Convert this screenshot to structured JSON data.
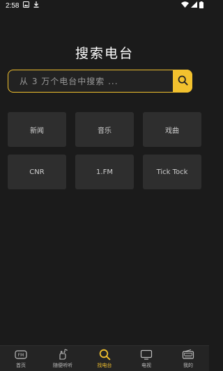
{
  "status": {
    "time": "2:58",
    "icons": [
      "image-icon",
      "download-icon",
      "wifi-icon",
      "signal-icon",
      "battery-icon"
    ]
  },
  "page": {
    "title": "搜索电台"
  },
  "search": {
    "placeholder": "从 3 万个电台中搜索 ...",
    "value": "",
    "accent_color": "#f2c12e"
  },
  "categories": [
    {
      "label": "新闻"
    },
    {
      "label": "音乐"
    },
    {
      "label": "戏曲"
    },
    {
      "label": "CNR"
    },
    {
      "label": "1.FM"
    },
    {
      "label": "Tick Tock"
    }
  ],
  "nav": [
    {
      "label": "首页",
      "icon": "fm-icon",
      "active": false
    },
    {
      "label": "随便听听",
      "icon": "hand-music-icon",
      "active": false
    },
    {
      "label": "找电台",
      "icon": "search-icon",
      "active": true
    },
    {
      "label": "电视",
      "icon": "tv-icon",
      "active": false
    },
    {
      "label": "我的",
      "icon": "radio-icon",
      "active": false
    }
  ]
}
